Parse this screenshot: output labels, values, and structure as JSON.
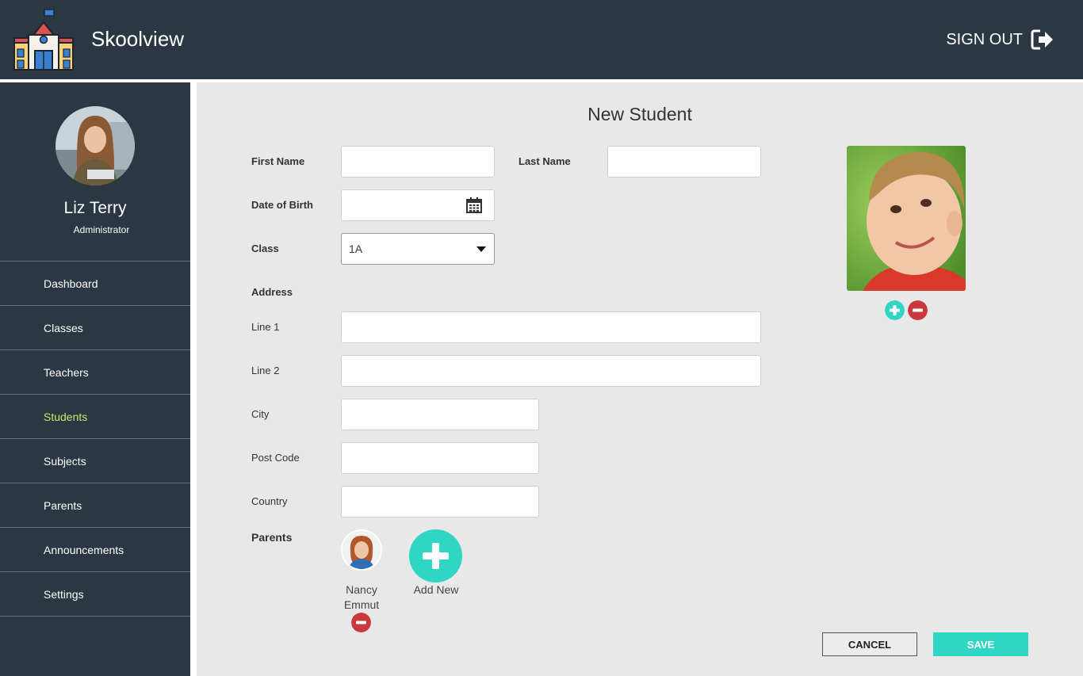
{
  "app": {
    "brand": "Skoolview",
    "sign_out_label": "SIGN OUT",
    "logo_icon": "school-building-icon",
    "sign_out_icon": "sign-out-icon"
  },
  "user": {
    "name": "Liz Terry",
    "role": "Administrator"
  },
  "nav": {
    "items": [
      {
        "label": "Dashboard"
      },
      {
        "label": "Classes"
      },
      {
        "label": "Teachers"
      },
      {
        "label": "Students",
        "active": true
      },
      {
        "label": "Subjects"
      },
      {
        "label": "Parents"
      },
      {
        "label": "Announcements"
      },
      {
        "label": "Settings"
      }
    ],
    "active_color": "#c7e86a"
  },
  "form": {
    "title": "New Student",
    "first_name_label": "First Name",
    "first_name_value": "",
    "last_name_label": "Last Name",
    "last_name_value": "",
    "dob_label": "Date of Birth",
    "dob_value": "",
    "class_label": "Class",
    "class_value": "1A",
    "address_heading": "Address",
    "line1_label": "Line 1",
    "line1_value": "",
    "line2_label": "Line 2",
    "line2_value": "",
    "city_label": "City",
    "city_value": "",
    "postcode_label": "Post Code",
    "postcode_value": "",
    "country_label": "Country",
    "country_value": "",
    "parents_label": "Parents",
    "parents": [
      {
        "name": "Nancy Emmut"
      }
    ],
    "add_new_label": "Add New"
  },
  "actions": {
    "cancel_label": "CANCEL",
    "save_label": "SAVE"
  },
  "colors": {
    "header_bg": "#2b3843",
    "main_bg": "#e8e8e8",
    "accent": "#2fd6c4",
    "remove": "#c9383f"
  }
}
